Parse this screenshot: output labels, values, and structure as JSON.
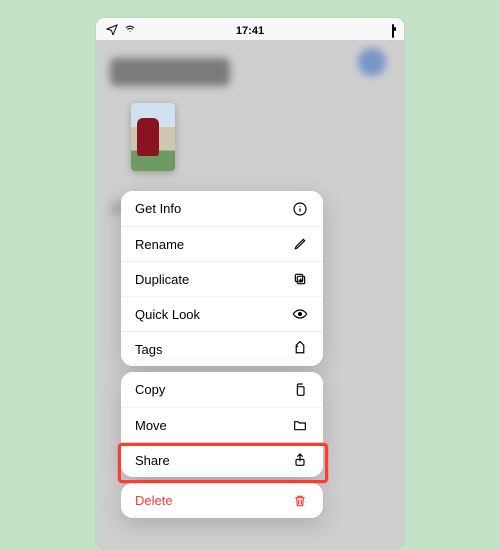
{
  "status": {
    "time": "17:41"
  },
  "menu": {
    "group1": {
      "get_info": "Get Info",
      "rename": "Rename",
      "duplicate": "Duplicate",
      "quick_look": "Quick Look",
      "tags": "Tags"
    },
    "group2": {
      "copy": "Copy",
      "move": "Move",
      "share": "Share"
    },
    "group3": {
      "delete": "Delete"
    }
  },
  "colors": {
    "destructive": "#ff3b30",
    "page_bg": "#c3e2c8"
  }
}
